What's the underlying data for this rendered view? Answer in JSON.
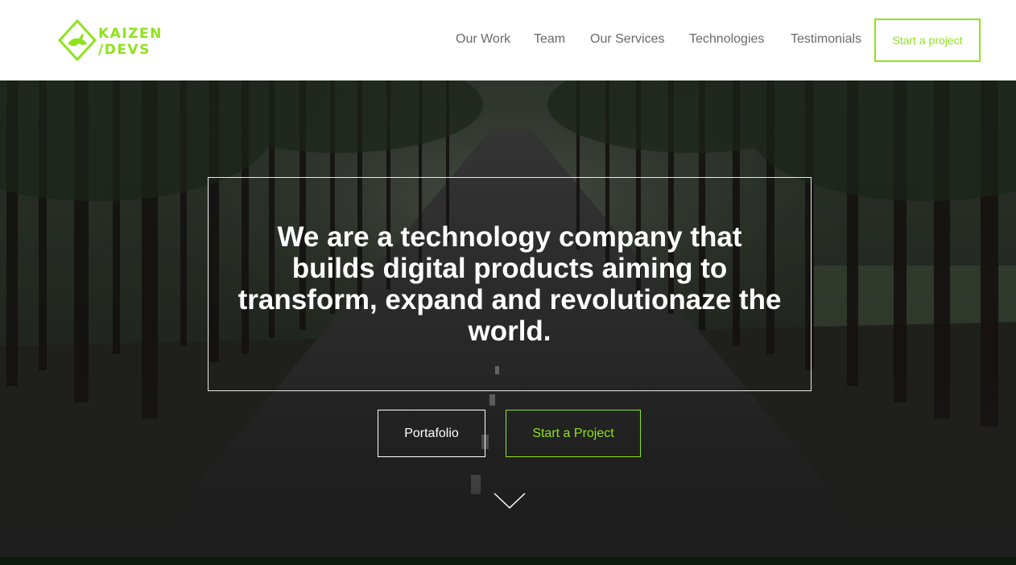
{
  "brand": {
    "line1": "KAIZEN",
    "line2": "/DEVS",
    "logo_icon": "diamond-rabbit-icon",
    "accent_color": "#8ee31b"
  },
  "nav": {
    "items": [
      {
        "label": "Our Work"
      },
      {
        "label": "Team"
      },
      {
        "label": "Our Services"
      },
      {
        "label": "Technologies"
      },
      {
        "label": "Testimonials"
      }
    ],
    "cta_label": "Start a project"
  },
  "hero": {
    "title": "We are a technology company that builds digital products aiming to transform, expand and revolutionaze the world.",
    "primary_button": "Portafolio",
    "secondary_button": "Start a Project",
    "scroll_icon": "chevron-down-icon",
    "background": "forest-road-photo"
  }
}
